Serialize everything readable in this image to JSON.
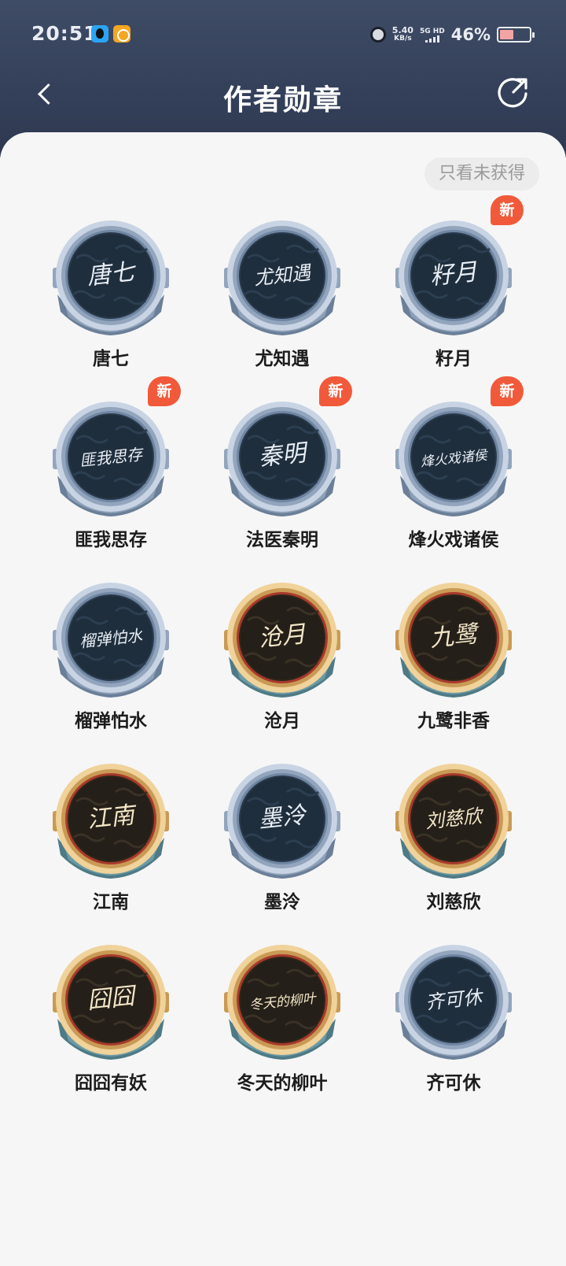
{
  "status_bar": {
    "time": "20:51",
    "net_speed_value": "5.40",
    "net_speed_unit": "KB/s",
    "network_label": "5G HD",
    "battery_percent": "46%",
    "battery_level": 0.46
  },
  "header": {
    "title": "作者勋章",
    "back_icon": "chevron-left-icon",
    "share_icon": "share-icon"
  },
  "filter": {
    "label": "只看未获得"
  },
  "new_tag_label": "新",
  "badges": [
    {
      "name": "唐七",
      "signature": "唐七",
      "tier": "silver",
      "is_new": false
    },
    {
      "name": "尤知遇",
      "signature": "尤知遇",
      "tier": "silver",
      "is_new": false
    },
    {
      "name": "籽月",
      "signature": "籽月",
      "tier": "silver",
      "is_new": true
    },
    {
      "name": "匪我思存",
      "signature": "匪我思存",
      "tier": "silver",
      "is_new": true
    },
    {
      "name": "法医秦明",
      "signature": "秦明",
      "tier": "silver",
      "is_new": true
    },
    {
      "name": "烽火戏诸侯",
      "signature": "烽火戏诸侯",
      "tier": "silver",
      "is_new": true
    },
    {
      "name": "榴弹怕水",
      "signature": "榴弹怕水",
      "tier": "silver",
      "is_new": false
    },
    {
      "name": "沧月",
      "signature": "沧月",
      "tier": "gold",
      "is_new": false
    },
    {
      "name": "九鹭非香",
      "signature": "九鹭",
      "tier": "gold",
      "is_new": false
    },
    {
      "name": "江南",
      "signature": "江南",
      "tier": "gold",
      "is_new": false
    },
    {
      "name": "墨泠",
      "signature": "墨泠",
      "tier": "silver",
      "is_new": false
    },
    {
      "name": "刘慈欣",
      "signature": "刘慈欣",
      "tier": "gold",
      "is_new": false
    },
    {
      "name": "囧囧有妖",
      "signature": "囧囧",
      "tier": "gold",
      "is_new": false
    },
    {
      "name": "冬天的柳叶",
      "signature": "冬天的柳叶",
      "tier": "gold",
      "is_new": false
    },
    {
      "name": "齐可休",
      "signature": "齐可休",
      "tier": "silver",
      "is_new": false
    }
  ],
  "colors": {
    "header_bg": "#3a4660",
    "content_bg": "#f6f6f6",
    "new_tag": "#f05a3a",
    "silver_rim": "#b8c6da",
    "silver_face": "#1f2e3c",
    "gold_rim": "#e6c083",
    "gold_face": "#241f18",
    "gold_ribbon": "#6c9aa4"
  }
}
